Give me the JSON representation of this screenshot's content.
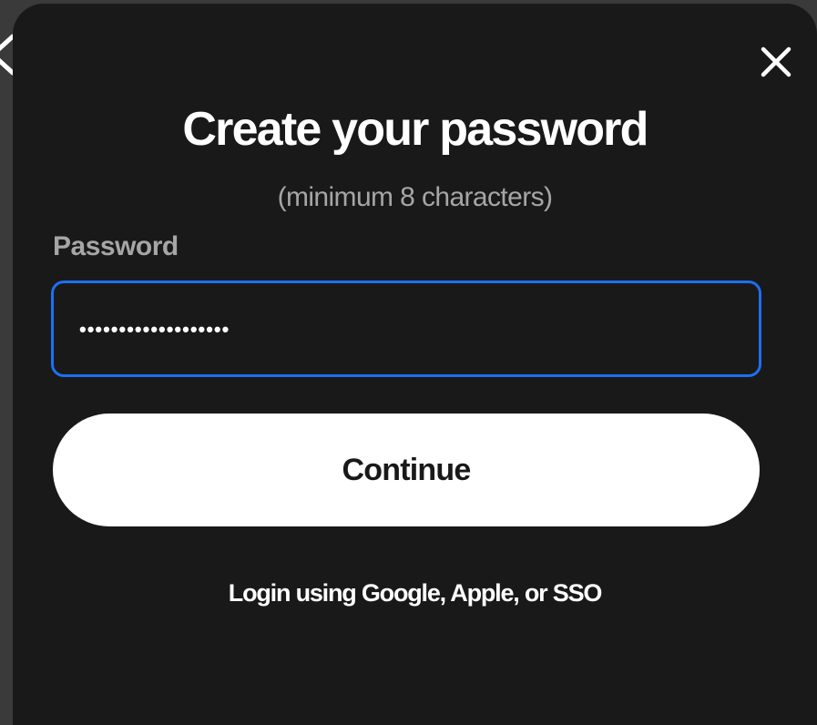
{
  "dialog": {
    "title": "Create your password",
    "subtitle": "(minimum 8 characters)",
    "password_label": "Password",
    "password_value": "•••••••••••••••••••",
    "continue_label": "Continue",
    "alt_login_label": "Login using Google, Apple, or SSO"
  },
  "icons": {
    "close": "close-icon",
    "back": "chevron-left-icon"
  },
  "colors": {
    "modal_background": "#191919",
    "accent_focus": "#1d6ff2",
    "primary_button": "#ffffff",
    "muted_text": "#a6a6a6"
  }
}
